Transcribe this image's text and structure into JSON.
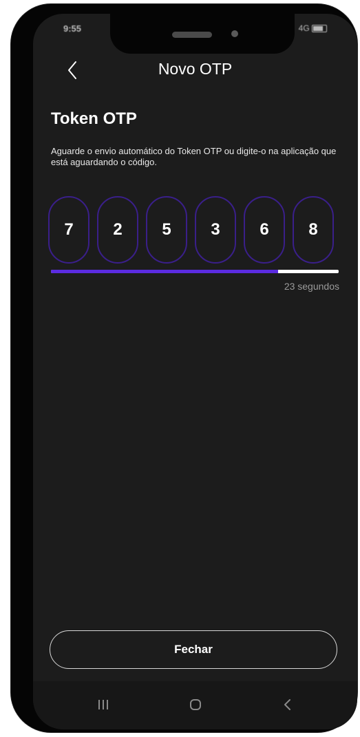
{
  "status_bar": {
    "time": "9:55",
    "signal": "4G"
  },
  "header": {
    "title": "Novo OTP"
  },
  "section": {
    "title": "Token OTP",
    "description": "Aguarde o envio automático do  Token OTP ou digite-o na aplicação que está aguardando o código."
  },
  "otp": {
    "digits": [
      "7",
      "2",
      "5",
      "3",
      "6",
      "8"
    ]
  },
  "timer": {
    "progress_fraction": 0.79,
    "label": "23 segundos"
  },
  "actions": {
    "close_label": "Fechar"
  },
  "colors": {
    "accent": "#5b2be0",
    "digit_border": "#3a1f8a",
    "background": "#1c1c1c"
  },
  "icons": {
    "back": "chevron-left-icon",
    "nav_recent": "recent-apps-icon",
    "nav_home": "home-icon",
    "nav_back": "nav-back-icon"
  }
}
